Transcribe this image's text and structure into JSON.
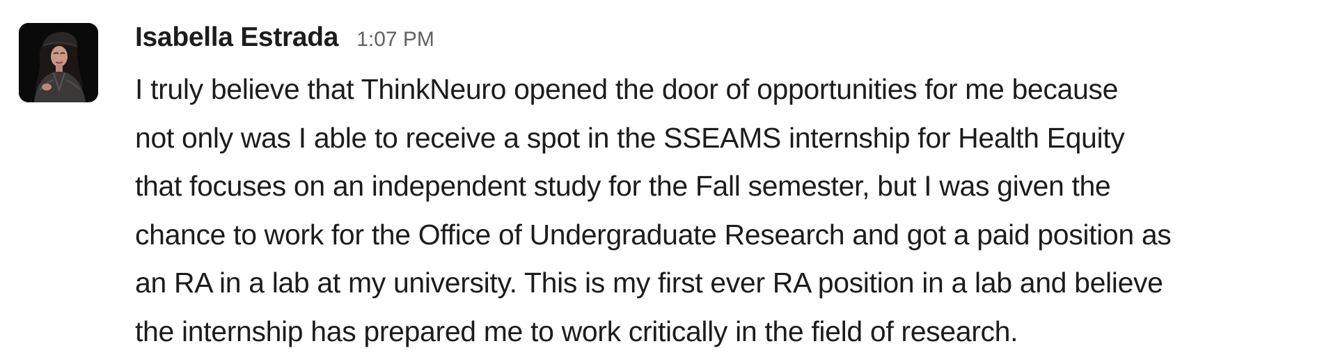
{
  "message": {
    "sender": "Isabella Estrada",
    "timestamp": "1:07 PM",
    "lines": [
      "I truly believe that ThinkNeuro opened the door of opportunities for me because",
      "not only was I able to receive a spot in the SSEAMS internship for Health Equity",
      "that focuses on an independent study for the Fall semester, but I was given the",
      "chance to work for the Office of Undergraduate Research and got a paid position as",
      "an RA in a lab at my university. This is my first ever RA position in a lab and believe",
      "the internship has prepared me to work critically in the field of research."
    ]
  }
}
